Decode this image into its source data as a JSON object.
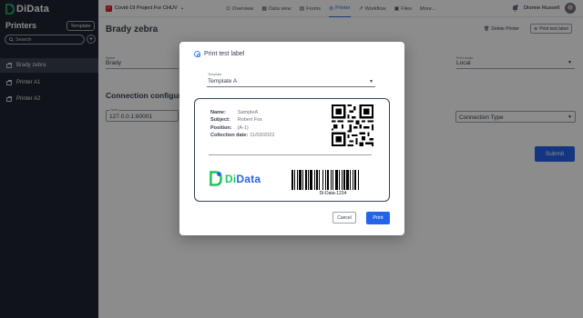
{
  "brand": {
    "name_part1": "Di",
    "name_part2": "Data"
  },
  "sidebar": {
    "title": "Printers",
    "template_button": "Template",
    "search_placeholder": "Search",
    "add_icon": "plus-icon",
    "items": [
      {
        "label": "Brady zebra",
        "active": true
      },
      {
        "label": "Printer A1",
        "active": false
      },
      {
        "label": "Printer A2",
        "active": false
      }
    ]
  },
  "topbar": {
    "project": "Covid-19 Project For CHUV",
    "nav": [
      {
        "label": "Overview",
        "icon": "overview-icon"
      },
      {
        "label": "Data view",
        "icon": "grid-icon"
      },
      {
        "label": "Forms",
        "icon": "forms-icon"
      },
      {
        "label": "Printer",
        "icon": "printer-icon",
        "active": true
      },
      {
        "label": "Workflow",
        "icon": "workflow-icon"
      },
      {
        "label": "Files",
        "icon": "files-icon"
      },
      {
        "label": "More...",
        "icon": ""
      }
    ],
    "user_name": "Dionne Russell"
  },
  "main": {
    "title": "Brady zebra",
    "delete_printer": "Delete Printer",
    "print_test_label": "Print test label",
    "name_label": "Name",
    "name_value": "Brady",
    "print_mode_label": "Print mode",
    "print_mode_value": "Local",
    "section_title": "Connection configura",
    "host_label": "Host",
    "host_value": "127.0.0.1:80001",
    "connection_type_value": "Connection Type",
    "submit_label": "Submit"
  },
  "modal": {
    "title": "Print test label",
    "template_label": "Template",
    "template_value": "Template A",
    "label": {
      "fields": [
        {
          "key": "Name:",
          "value": "SampleA"
        },
        {
          "key": "Subject:",
          "value": "Robert Fox"
        },
        {
          "key": "Position:",
          "value": "(A-1)"
        },
        {
          "key": "Collection date:",
          "value": "11/03/2022"
        }
      ],
      "brand_part1": "Di",
      "brand_part2": "Data",
      "barcode_text": "Di-Data-1234"
    },
    "cancel_label": "Cancel",
    "print_label": "Print"
  },
  "colors": {
    "accent": "#2563eb",
    "brand_green": "#22c55e",
    "sidebar_bg": "#1e2430"
  }
}
